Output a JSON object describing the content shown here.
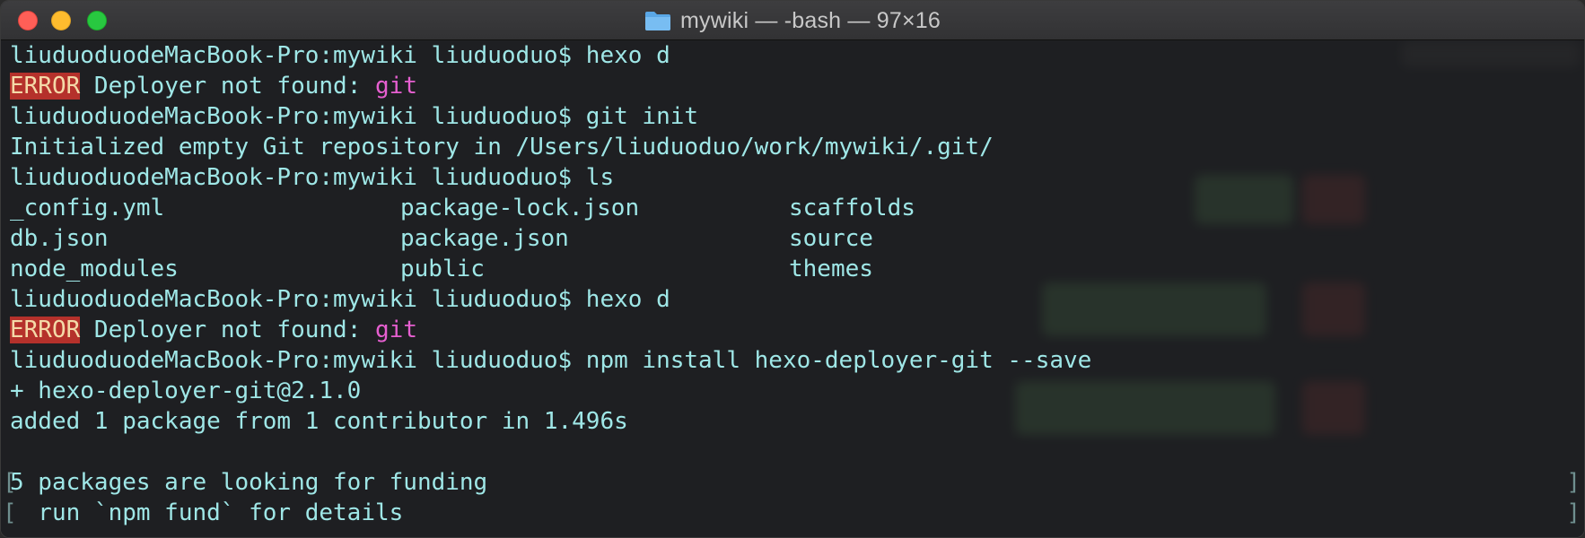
{
  "window": {
    "title": "mywiki — -bash — 97×16"
  },
  "terminal": {
    "lines": [
      {
        "type": "prompt",
        "prompt": "liuduoduodeMacBook-Pro:mywiki liuduoduo$ ",
        "command": "hexo d"
      },
      {
        "type": "error",
        "badge": "ERROR",
        "text": " Deployer not found: ",
        "highlight": "git"
      },
      {
        "type": "prompt",
        "prompt": "liuduoduodeMacBook-Pro:mywiki liuduoduo$ ",
        "command": "git init"
      },
      {
        "type": "text",
        "text": "Initialized empty Git repository in /Users/liuduoduo/work/mywiki/.git/"
      },
      {
        "type": "prompt",
        "prompt": "liuduoduodeMacBook-Pro:mywiki liuduoduo$ ",
        "command": "ls"
      },
      {
        "type": "cols",
        "cols": [
          "_config.yml",
          "package-lock.json",
          "scaffolds"
        ]
      },
      {
        "type": "cols",
        "cols": [
          "db.json",
          "package.json",
          "source"
        ]
      },
      {
        "type": "cols",
        "cols": [
          "node_modules",
          "public",
          "themes"
        ]
      },
      {
        "type": "prompt",
        "prompt": "liuduoduodeMacBook-Pro:mywiki liuduoduo$ ",
        "command": "hexo d"
      },
      {
        "type": "error",
        "badge": "ERROR",
        "text": " Deployer not found: ",
        "highlight": "git"
      },
      {
        "type": "prompt",
        "prompt": "liuduoduodeMacBook-Pro:mywiki liuduoduo$ ",
        "command": "npm install hexo-deployer-git --save"
      },
      {
        "type": "text",
        "text": "+ hexo-deployer-git@2.1.0"
      },
      {
        "type": "text",
        "text": "added 1 package from 1 contributor in 1.496s"
      },
      {
        "type": "text",
        "text": ""
      },
      {
        "type": "text",
        "text": "5 packages are looking for funding"
      },
      {
        "type": "text",
        "text": "  run `npm fund` for details"
      }
    ]
  },
  "colors": {
    "text": "#9fe7e7",
    "error_bg": "#b5312b",
    "highlight": "#e65fd0"
  },
  "icons": {
    "title_icon": "folder-icon"
  }
}
